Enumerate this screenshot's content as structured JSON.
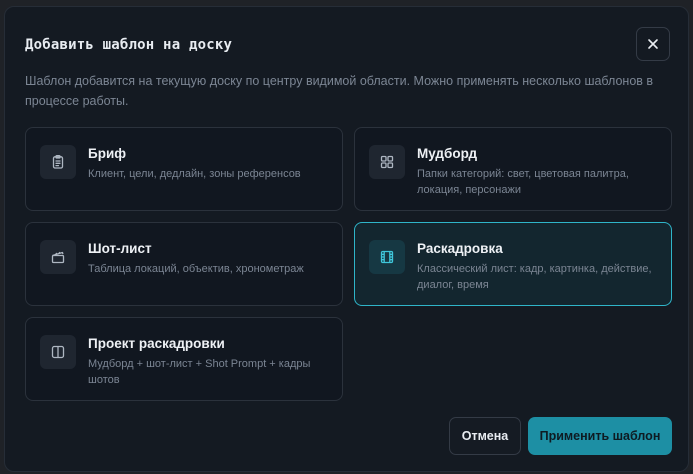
{
  "dialog": {
    "title": "Добавить шаблон на доску",
    "description": "Шаблон добавится на текущую доску по центру видимой области. Можно применять несколько шаблонов в процессе работы.",
    "close_icon": "close-icon"
  },
  "templates": [
    {
      "title": "Бриф",
      "subtitle": "Клиент, цели, дедлайн, зоны референсов",
      "icon": "clipboard-icon",
      "selected": false
    },
    {
      "title": "Мудборд",
      "subtitle": "Папки категорий: свет, цветовая палитра, локация, персонажи",
      "icon": "grid-icon",
      "selected": false
    },
    {
      "title": "Шот-лист",
      "subtitle": "Таблица локаций, объектив, хронометраж",
      "icon": "clapperboard-icon",
      "selected": false
    },
    {
      "title": "Раскадровка",
      "subtitle": "Классический лист: кадр, картинка, действие, диалог, время",
      "icon": "film-icon",
      "selected": true
    },
    {
      "title": "Проект раскадровки",
      "subtitle": "Мудборд + шот-лист + Shot Prompt + кадры шотов",
      "icon": "columns-icon",
      "selected": false
    }
  ],
  "footer": {
    "cancel_label": "Отмена",
    "apply_label": "Применить шаблон"
  },
  "colors": {
    "accent": "#2fb5c9",
    "primary_button": "#1d8fa4",
    "dialog_bg": "#141a22"
  }
}
